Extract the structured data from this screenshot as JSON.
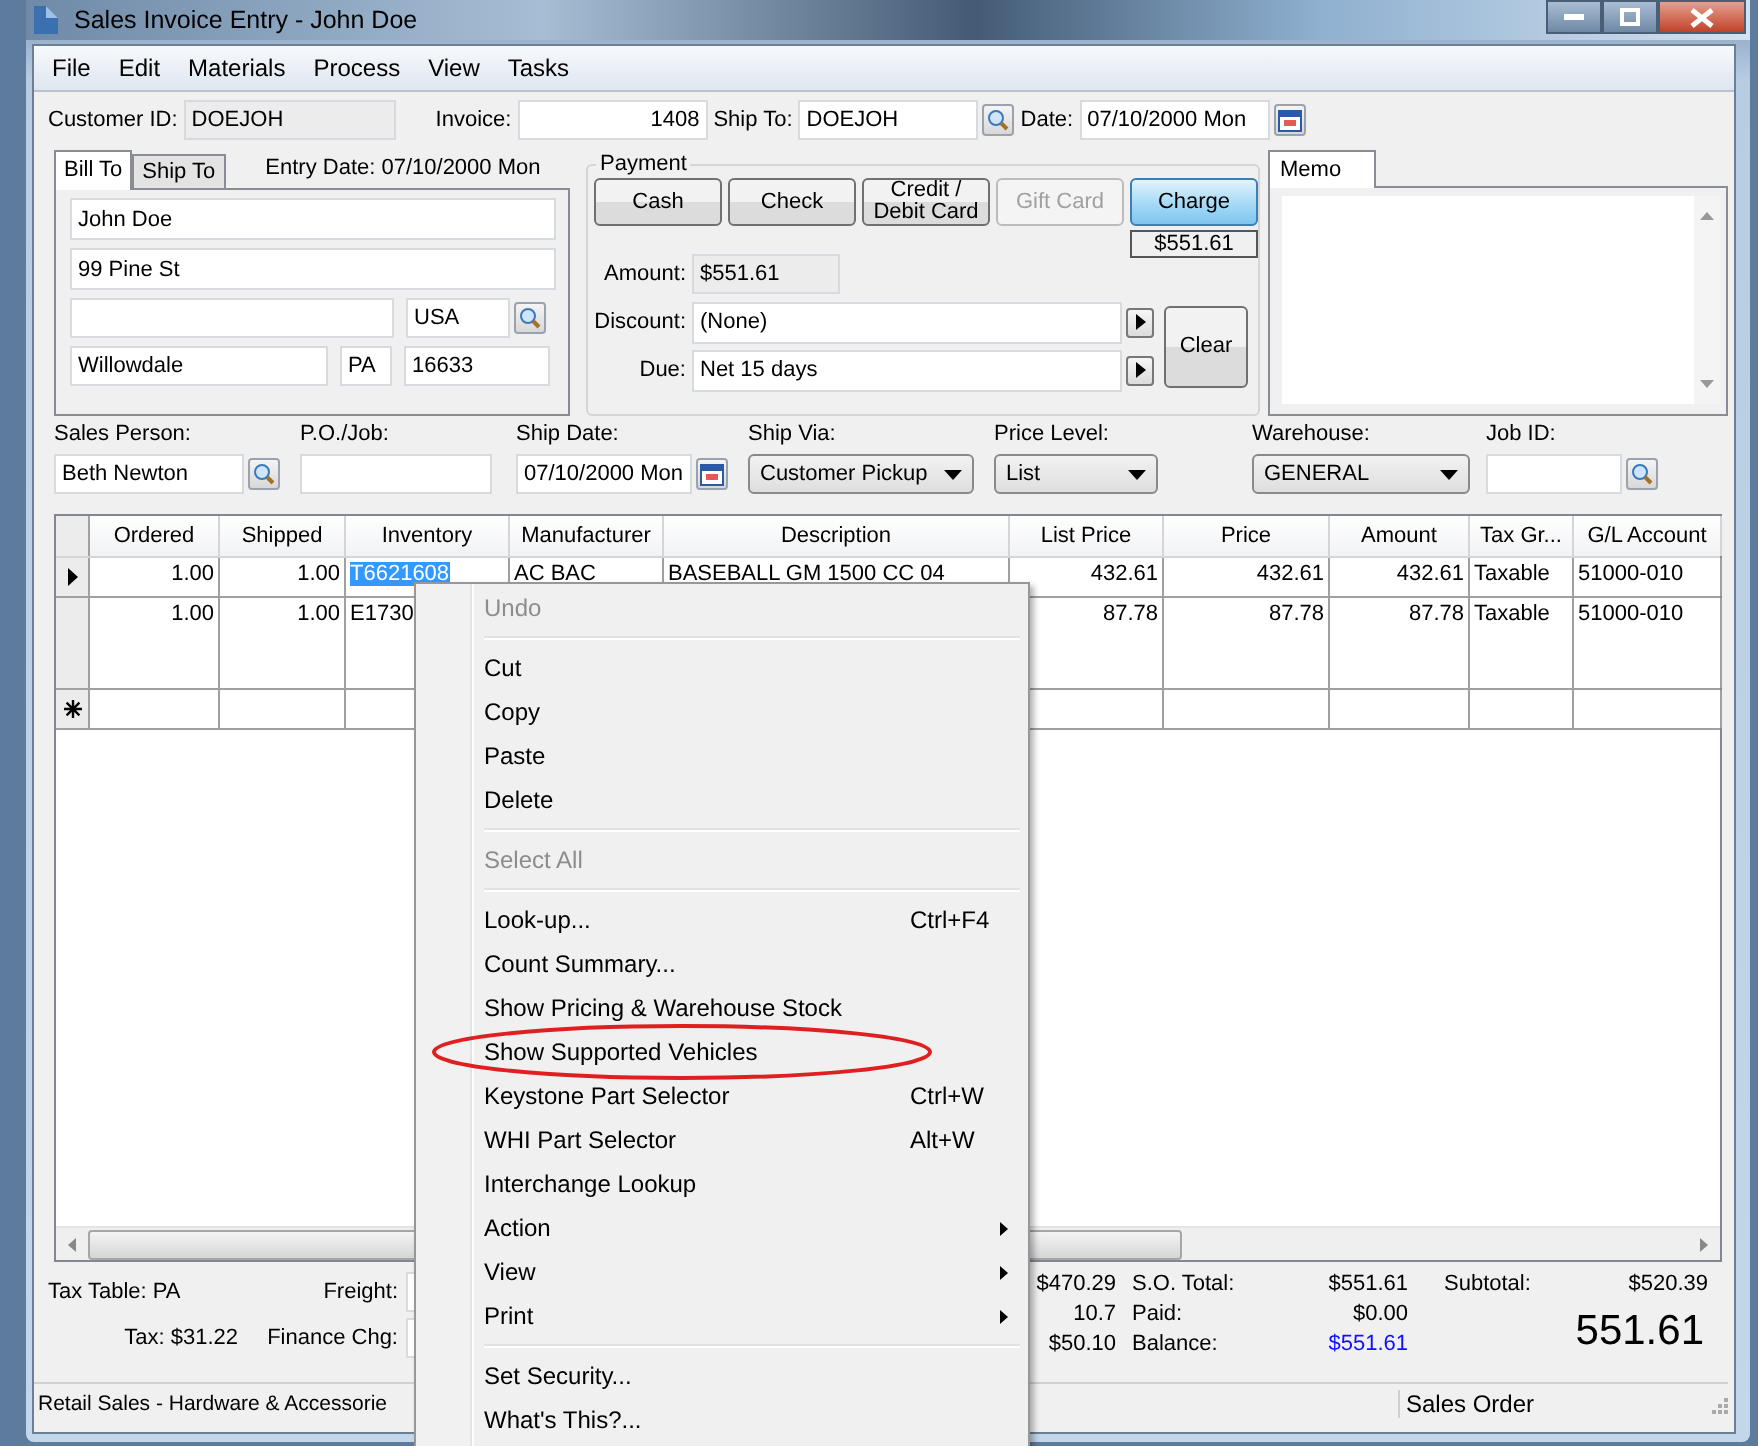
{
  "window": {
    "title": "Sales Invoice Entry - John Doe"
  },
  "menu_bar": [
    "File",
    "Edit",
    "Materials",
    "Process",
    "View",
    "Tasks"
  ],
  "header": {
    "customer_id_label": "Customer ID:",
    "customer_id": "DOEJOH",
    "invoice_label": "Invoice:",
    "invoice": "1408",
    "ship_to_label": "Ship To:",
    "ship_to": "DOEJOH",
    "date_label": "Date:",
    "date": "07/10/2000 Mon"
  },
  "address": {
    "tabs": [
      {
        "label": "Bill To",
        "selected": true
      },
      {
        "label": "Ship To",
        "selected": false
      }
    ],
    "entry_date": "Entry Date:  07/10/2000 Mon",
    "name": "John Doe",
    "street": "99 Pine St",
    "country": "USA",
    "city": "Willowdale",
    "state": "PA",
    "zip": "16633"
  },
  "payment": {
    "title": "Payment",
    "buttons": [
      {
        "label": "Cash",
        "disabled": false,
        "selected": false
      },
      {
        "label": "Check",
        "disabled": false,
        "selected": false
      },
      {
        "label": "Credit /\nDebit Card",
        "disabled": false,
        "selected": false
      },
      {
        "label": "Gift Card",
        "disabled": true,
        "selected": false
      },
      {
        "label": "Charge",
        "disabled": false,
        "selected": true
      }
    ],
    "charge_total": "$551.61",
    "amount_label": "Amount:",
    "amount": "$551.61",
    "discount_label": "Discount:",
    "discount": "(None)",
    "due_label": "Due:",
    "due": "Net 15  days",
    "clear": "Clear"
  },
  "memo": {
    "tab": "Memo"
  },
  "order_fields": [
    {
      "label": "Sales Person:",
      "value": "Beth Newton",
      "kind": "lookup"
    },
    {
      "label": "P.O./Job:",
      "kind": "text"
    },
    {
      "label": "Ship Date:",
      "value": "07/10/2000 Mon",
      "kind": "date"
    },
    {
      "label": "Ship Via:",
      "value": "Customer Pickup",
      "kind": "dropdown"
    },
    {
      "label": "Price Level:",
      "value": "List",
      "kind": "dropdown"
    },
    {
      "label": "Warehouse:",
      "value": "GENERAL",
      "kind": "dropdown"
    },
    {
      "label": "Job ID:",
      "kind": "lookup"
    }
  ],
  "grid": {
    "columns": [
      "Ordered",
      "Shipped",
      "Inventory",
      "Manufacturer",
      "Description",
      "List Price",
      "Price",
      "Amount",
      "Tax Gr...",
      "G/L Account"
    ],
    "rows": [
      {
        "kind": "item",
        "current": true,
        "cells": [
          {
            "text": "1.00",
            "selected": false
          },
          {
            "text": "1.00",
            "selected": false
          },
          {
            "text": "T6621608",
            "selected": true
          },
          {
            "text": "AC BAC",
            "selected": false
          },
          {
            "text": "BASEBALL GM 1500 CC 04",
            "selected": false
          }
        ],
        "right_cells": [
          "432.61",
          "432.61",
          "432.61",
          "Taxable",
          "51000-010"
        ]
      },
      {
        "kind": "item",
        "current": false,
        "cells": [
          {
            "text": "1.00",
            "selected": false
          },
          {
            "text": "1.00",
            "selected": false
          },
          {
            "text": "E1730",
            "selected": false
          }
        ],
        "right_cells": [
          "87.78",
          "87.78",
          "87.78",
          "Taxable",
          "51000-010"
        ]
      },
      {
        "kind": "new",
        "current": false
      }
    ]
  },
  "footer": {
    "tax_table": "Tax Table: PA",
    "tax": "Tax: $31.22",
    "freight_label": "Freight:",
    "finance_label": "Finance Chg:",
    "values": [
      "$470.29",
      "10.7",
      "$50.10"
    ],
    "totals": [
      {
        "label": "S.O. Total:",
        "value": "$551.61",
        "kind": "plain"
      },
      {
        "label": "Paid:",
        "value": "$0.00",
        "kind": "plain"
      },
      {
        "label": "Balance:",
        "value": "$551.61",
        "kind": "balance"
      }
    ],
    "subtotal_label": "Subtotal:",
    "subtotal": "$520.39",
    "grand_total": "551.61"
  },
  "status_bar": [
    "Retail Sales - Hardware & Accessorie",
    "Sales Order"
  ],
  "context_menu": [
    {
      "kind": "command",
      "label": "Undo",
      "disabled": true,
      "circled": false
    },
    {
      "kind": "separator"
    },
    {
      "kind": "command",
      "label": "Cut",
      "disabled": false,
      "circled": false
    },
    {
      "kind": "command",
      "label": "Copy",
      "disabled": false,
      "circled": false
    },
    {
      "kind": "command",
      "label": "Paste",
      "disabled": false,
      "circled": false
    },
    {
      "kind": "command",
      "label": "Delete",
      "disabled": false,
      "circled": false
    },
    {
      "kind": "separator"
    },
    {
      "kind": "command",
      "label": "Select All",
      "disabled": true,
      "circled": false
    },
    {
      "kind": "separator"
    },
    {
      "kind": "command",
      "label": "Look-up...",
      "shortcut": "Ctrl+F4",
      "disabled": false,
      "circled": false
    },
    {
      "kind": "command",
      "label": "Count Summary...",
      "disabled": false,
      "circled": false
    },
    {
      "kind": "command",
      "label": "Show Pricing & Warehouse Stock",
      "disabled": false,
      "circled": false
    },
    {
      "kind": "command",
      "label": "Show Supported Vehicles",
      "disabled": false,
      "circled": true
    },
    {
      "kind": "command",
      "label": "Keystone Part Selector",
      "shortcut": "Ctrl+W",
      "disabled": false,
      "circled": false
    },
    {
      "kind": "command",
      "label": "WHI Part Selector",
      "shortcut": "Alt+W",
      "disabled": false,
      "circled": false
    },
    {
      "kind": "command",
      "label": "Interchange Lookup",
      "disabled": false,
      "circled": false
    },
    {
      "kind": "submenu",
      "label": "Action",
      "disabled": false,
      "circled": false
    },
    {
      "kind": "submenu",
      "label": "View",
      "disabled": false,
      "circled": false
    },
    {
      "kind": "submenu",
      "label": "Print",
      "disabled": false,
      "circled": false
    },
    {
      "kind": "separator"
    },
    {
      "kind": "command",
      "label": "Set Security...",
      "disabled": false,
      "circled": false
    },
    {
      "kind": "command",
      "label": "What's This?...",
      "disabled": false,
      "circled": false
    }
  ]
}
